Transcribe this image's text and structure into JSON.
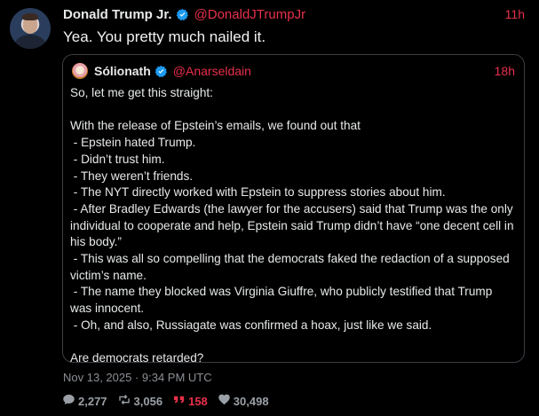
{
  "tweet": {
    "author_name": "Donald Trump Jr.",
    "author_handle": "@DonaldJTrumpJr",
    "time": "11h",
    "text": "Yea. You pretty much nailed it.",
    "date": "Nov 13, 2025 · 9:34 PM UTC"
  },
  "quoted": {
    "author_name": "Sólionath",
    "author_handle": "@Anarseldain",
    "time": "18h",
    "text": "So, let me get this straight:\n\nWith the release of Epstein’s emails, we found out that\n - Epstein hated Trump.\n - Didn’t trust him.\n - They weren’t friends.\n - The NYT directly worked with Epstein to suppress stories about him.\n - After Bradley Edwards (the lawyer for the accusers) said that Trump was the only individual to cooperate and help, Epstein said Trump didn’t have “one decent cell in his body.”\n - This was all so compelling that the democrats faked the redaction of a supposed victim’s name.\n - The name they blocked was Virginia Giuffre, who publicly testified that Trump was innocent.\n - Oh, and also, Russiagate was confirmed a hoax, just like we said.\n\nAre democrats retarded?"
  },
  "stats": {
    "replies": "2,277",
    "retweets": "3,056",
    "quotes": "158",
    "likes": "30,498"
  },
  "icons": {
    "verified": "verified-badge-icon",
    "reply": "reply-icon",
    "retweet": "retweet-icon",
    "quote": "quote-icon",
    "like": "heart-icon"
  },
  "colors": {
    "accent": "#e8304a",
    "verified": "#1d9bf0",
    "background": "#000000"
  }
}
